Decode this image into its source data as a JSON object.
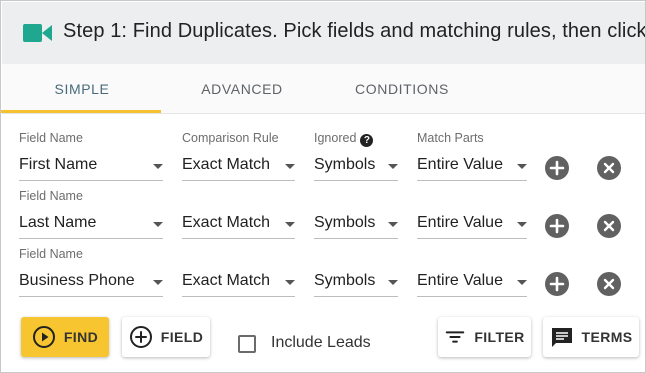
{
  "header": {
    "title": "Step 1: Find Duplicates. Pick fields and matching rules, then click",
    "icon": "video-camera-icon",
    "accent": "#1fa88f"
  },
  "tabs": [
    {
      "label": "SIMPLE",
      "active": true
    },
    {
      "label": "ADVANCED",
      "active": false
    },
    {
      "label": "CONDITIONS",
      "active": false
    }
  ],
  "rows": [
    {
      "field_label": "Field Name",
      "field_value": "First Name",
      "rule_label": "Comparison Rule",
      "rule_value": "Exact Match",
      "ignored_label": "Ignored",
      "ignored_value": "Symbols",
      "parts_label": "Match Parts",
      "parts_value": "Entire Value"
    },
    {
      "field_label": "Field Name",
      "field_value": "Last Name",
      "rule_value": "Exact Match",
      "ignored_value": "Symbols",
      "parts_value": "Entire Value"
    },
    {
      "field_label": "Field Name",
      "field_value": "Business Phone",
      "rule_value": "Exact Match",
      "ignored_value": "Symbols",
      "parts_value": "Entire Value"
    }
  ],
  "help_glyph": "?",
  "actions": {
    "find_label": "FIND",
    "field_label": "FIELD",
    "include_leads_label": "Include Leads",
    "include_leads_checked": false,
    "filter_label": "FILTER",
    "terms_label": "TERMS"
  },
  "colors": {
    "primary_button": "#f7c52f",
    "tab_indicator": "#f5c12e",
    "header_bg": "#eceeef"
  }
}
